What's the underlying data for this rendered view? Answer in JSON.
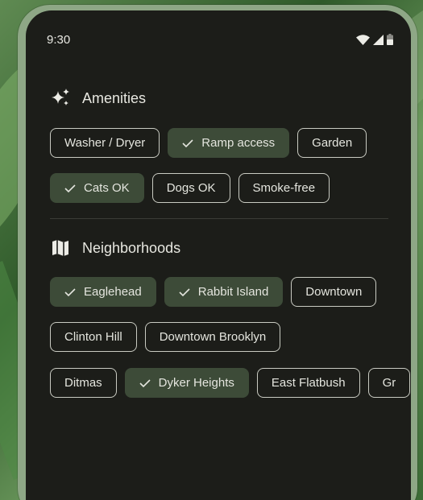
{
  "status_bar": {
    "time": "9:30",
    "wifi_icon": "wifi-icon",
    "signal_icon": "signal-icon",
    "battery_icon": "battery-icon"
  },
  "amenities": {
    "title": "Amenities",
    "icon": "sparkle-icon",
    "chips": [
      {
        "label": "Washer / Dryer",
        "selected": false
      },
      {
        "label": "Ramp access",
        "selected": true
      },
      {
        "label": "Garden",
        "selected": false
      },
      {
        "label": "Cats OK",
        "selected": true
      },
      {
        "label": "Dogs OK",
        "selected": false
      },
      {
        "label": "Smoke-free",
        "selected": false
      }
    ]
  },
  "neighborhoods": {
    "title": "Neighborhoods",
    "icon": "map-icon",
    "chips": [
      {
        "label": "Eaglehead",
        "selected": true
      },
      {
        "label": "Rabbit Island",
        "selected": true
      },
      {
        "label": "Downtown",
        "selected": false
      },
      {
        "label": "Clinton Hill",
        "selected": false
      },
      {
        "label": "Downtown Brooklyn",
        "selected": false
      },
      {
        "label": "Ditmas",
        "selected": false
      },
      {
        "label": "Dyker Heights",
        "selected": true
      },
      {
        "label": "East Flatbush",
        "selected": false
      },
      {
        "label": "Gr",
        "selected": false
      }
    ]
  },
  "colors": {
    "surface": "#1c1d19",
    "selected_chip": "#3d4b38",
    "chip_outline": "#c9cbc2",
    "text": "#e4e5de"
  }
}
